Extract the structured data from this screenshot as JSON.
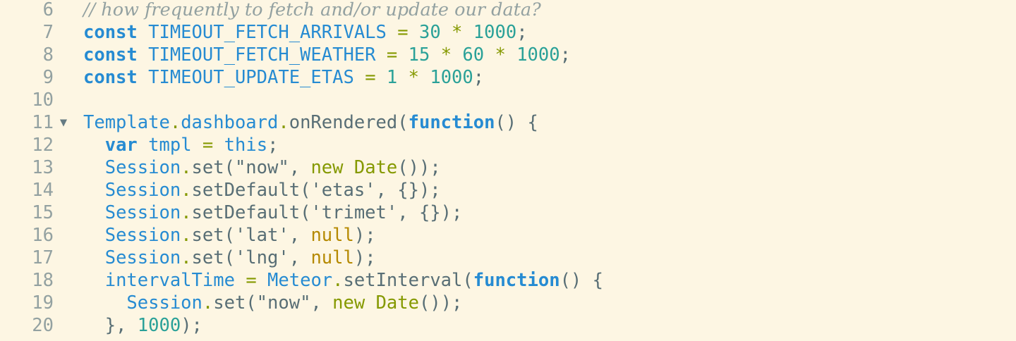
{
  "colors": {
    "background": "#fdf6e3",
    "line_number": "#93a1a1",
    "keyword": "#268bd2",
    "number": "#2aa198",
    "operator": "#859900",
    "text": "#586e75",
    "null": "#b58900",
    "comment": "#93a1a1"
  },
  "editor": {
    "fold_marker_icon": "triangle-down-icon",
    "fold_marker_glyph": "▼",
    "lines": [
      {
        "number": "6",
        "tokens": [
          {
            "t": "comment",
            "v": "// how frequently to fetch and/or update our data?"
          }
        ]
      },
      {
        "number": "7",
        "tokens": [
          {
            "t": "kw",
            "v": "const"
          },
          {
            "t": "text",
            "v": " "
          },
          {
            "t": "ident",
            "v": "TIMEOUT_FETCH_ARRIVALS"
          },
          {
            "t": "text",
            "v": " "
          },
          {
            "t": "op",
            "v": "="
          },
          {
            "t": "text",
            "v": " "
          },
          {
            "t": "num",
            "v": "30"
          },
          {
            "t": "text",
            "v": " "
          },
          {
            "t": "op",
            "v": "*"
          },
          {
            "t": "text",
            "v": " "
          },
          {
            "t": "num",
            "v": "1000"
          },
          {
            "t": "punct",
            "v": ";"
          }
        ]
      },
      {
        "number": "8",
        "tokens": [
          {
            "t": "kw",
            "v": "const"
          },
          {
            "t": "text",
            "v": " "
          },
          {
            "t": "ident",
            "v": "TIMEOUT_FETCH_WEATHER"
          },
          {
            "t": "text",
            "v": " "
          },
          {
            "t": "op",
            "v": "="
          },
          {
            "t": "text",
            "v": " "
          },
          {
            "t": "num",
            "v": "15"
          },
          {
            "t": "text",
            "v": " "
          },
          {
            "t": "op",
            "v": "*"
          },
          {
            "t": "text",
            "v": " "
          },
          {
            "t": "num",
            "v": "60"
          },
          {
            "t": "text",
            "v": " "
          },
          {
            "t": "op",
            "v": "*"
          },
          {
            "t": "text",
            "v": " "
          },
          {
            "t": "num",
            "v": "1000"
          },
          {
            "t": "punct",
            "v": ";"
          }
        ]
      },
      {
        "number": "9",
        "tokens": [
          {
            "t": "kw",
            "v": "const"
          },
          {
            "t": "text",
            "v": " "
          },
          {
            "t": "ident",
            "v": "TIMEOUT_UPDATE_ETAS"
          },
          {
            "t": "text",
            "v": " "
          },
          {
            "t": "op",
            "v": "="
          },
          {
            "t": "text",
            "v": " "
          },
          {
            "t": "num",
            "v": "1"
          },
          {
            "t": "text",
            "v": " "
          },
          {
            "t": "op",
            "v": "*"
          },
          {
            "t": "text",
            "v": " "
          },
          {
            "t": "num",
            "v": "1000"
          },
          {
            "t": "punct",
            "v": ";"
          }
        ]
      },
      {
        "number": "10",
        "tokens": []
      },
      {
        "number": "11",
        "fold": true,
        "tokens": [
          {
            "t": "ident",
            "v": "Template"
          },
          {
            "t": "dot",
            "v": "."
          },
          {
            "t": "ident",
            "v": "dashboard"
          },
          {
            "t": "dot",
            "v": "."
          },
          {
            "t": "text",
            "v": "onRendered("
          },
          {
            "t": "kw",
            "v": "function"
          },
          {
            "t": "text",
            "v": "() {"
          }
        ]
      },
      {
        "number": "12",
        "tokens": [
          {
            "t": "text",
            "v": "  "
          },
          {
            "t": "kw",
            "v": "var"
          },
          {
            "t": "text",
            "v": " "
          },
          {
            "t": "ident",
            "v": "tmpl"
          },
          {
            "t": "text",
            "v": " "
          },
          {
            "t": "op",
            "v": "="
          },
          {
            "t": "text",
            "v": " "
          },
          {
            "t": "this",
            "v": "this"
          },
          {
            "t": "punct",
            "v": ";"
          }
        ]
      },
      {
        "number": "13",
        "tokens": [
          {
            "t": "text",
            "v": "  "
          },
          {
            "t": "ident",
            "v": "Session"
          },
          {
            "t": "dot",
            "v": "."
          },
          {
            "t": "text",
            "v": "set(\"now\", "
          },
          {
            "t": "ctor",
            "v": "new"
          },
          {
            "t": "text",
            "v": " "
          },
          {
            "t": "ctor",
            "v": "Date"
          },
          {
            "t": "text",
            "v": "());"
          }
        ]
      },
      {
        "number": "14",
        "tokens": [
          {
            "t": "text",
            "v": "  "
          },
          {
            "t": "ident",
            "v": "Session"
          },
          {
            "t": "dot",
            "v": "."
          },
          {
            "t": "text",
            "v": "setDefault('etas', {});"
          }
        ]
      },
      {
        "number": "15",
        "tokens": [
          {
            "t": "text",
            "v": "  "
          },
          {
            "t": "ident",
            "v": "Session"
          },
          {
            "t": "dot",
            "v": "."
          },
          {
            "t": "text",
            "v": "setDefault('trimet', {});"
          }
        ]
      },
      {
        "number": "16",
        "tokens": [
          {
            "t": "text",
            "v": "  "
          },
          {
            "t": "ident",
            "v": "Session"
          },
          {
            "t": "dot",
            "v": "."
          },
          {
            "t": "text",
            "v": "set('lat', "
          },
          {
            "t": "null",
            "v": "null"
          },
          {
            "t": "text",
            "v": ");"
          }
        ]
      },
      {
        "number": "17",
        "tokens": [
          {
            "t": "text",
            "v": "  "
          },
          {
            "t": "ident",
            "v": "Session"
          },
          {
            "t": "dot",
            "v": "."
          },
          {
            "t": "text",
            "v": "set('lng', "
          },
          {
            "t": "null",
            "v": "null"
          },
          {
            "t": "text",
            "v": ");"
          }
        ]
      },
      {
        "number": "18",
        "tokens": [
          {
            "t": "text",
            "v": "  "
          },
          {
            "t": "ident",
            "v": "intervalTime"
          },
          {
            "t": "text",
            "v": " "
          },
          {
            "t": "op",
            "v": "="
          },
          {
            "t": "text",
            "v": " "
          },
          {
            "t": "ident",
            "v": "Meteor"
          },
          {
            "t": "dot",
            "v": "."
          },
          {
            "t": "text",
            "v": "setInterval("
          },
          {
            "t": "kw",
            "v": "function"
          },
          {
            "t": "text",
            "v": "() {"
          }
        ]
      },
      {
        "number": "19",
        "tokens": [
          {
            "t": "text",
            "v": "    "
          },
          {
            "t": "ident",
            "v": "Session"
          },
          {
            "t": "dot",
            "v": "."
          },
          {
            "t": "text",
            "v": "set(\"now\", "
          },
          {
            "t": "ctor",
            "v": "new"
          },
          {
            "t": "text",
            "v": " "
          },
          {
            "t": "ctor",
            "v": "Date"
          },
          {
            "t": "text",
            "v": "());"
          }
        ]
      },
      {
        "number": "20",
        "tokens": [
          {
            "t": "text",
            "v": "  }, "
          },
          {
            "t": "num",
            "v": "1000"
          },
          {
            "t": "text",
            "v": ");"
          }
        ]
      }
    ]
  }
}
